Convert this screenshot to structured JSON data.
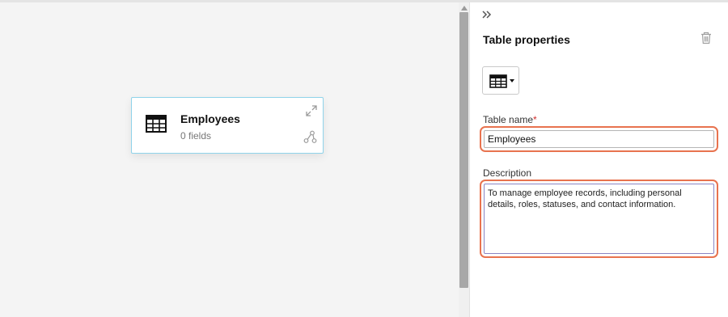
{
  "canvas": {
    "node": {
      "title": "Employees",
      "subtitle": "0 fields",
      "icon": "table-grid-icon",
      "border_color": "#8fd3ea"
    }
  },
  "panel": {
    "collapse_icon": "double-chevron-right-icon",
    "title": "Table properties",
    "delete_icon": "trash-icon",
    "table_icon": "table-grid-icon",
    "table_name_label": "Table name",
    "required_mark": "*",
    "table_name_value": "Employees",
    "description_label": "Description",
    "description_value": "To manage employee records, including personal details, roles, statuses, and contact information.",
    "highlight_color": "#e8734f"
  }
}
